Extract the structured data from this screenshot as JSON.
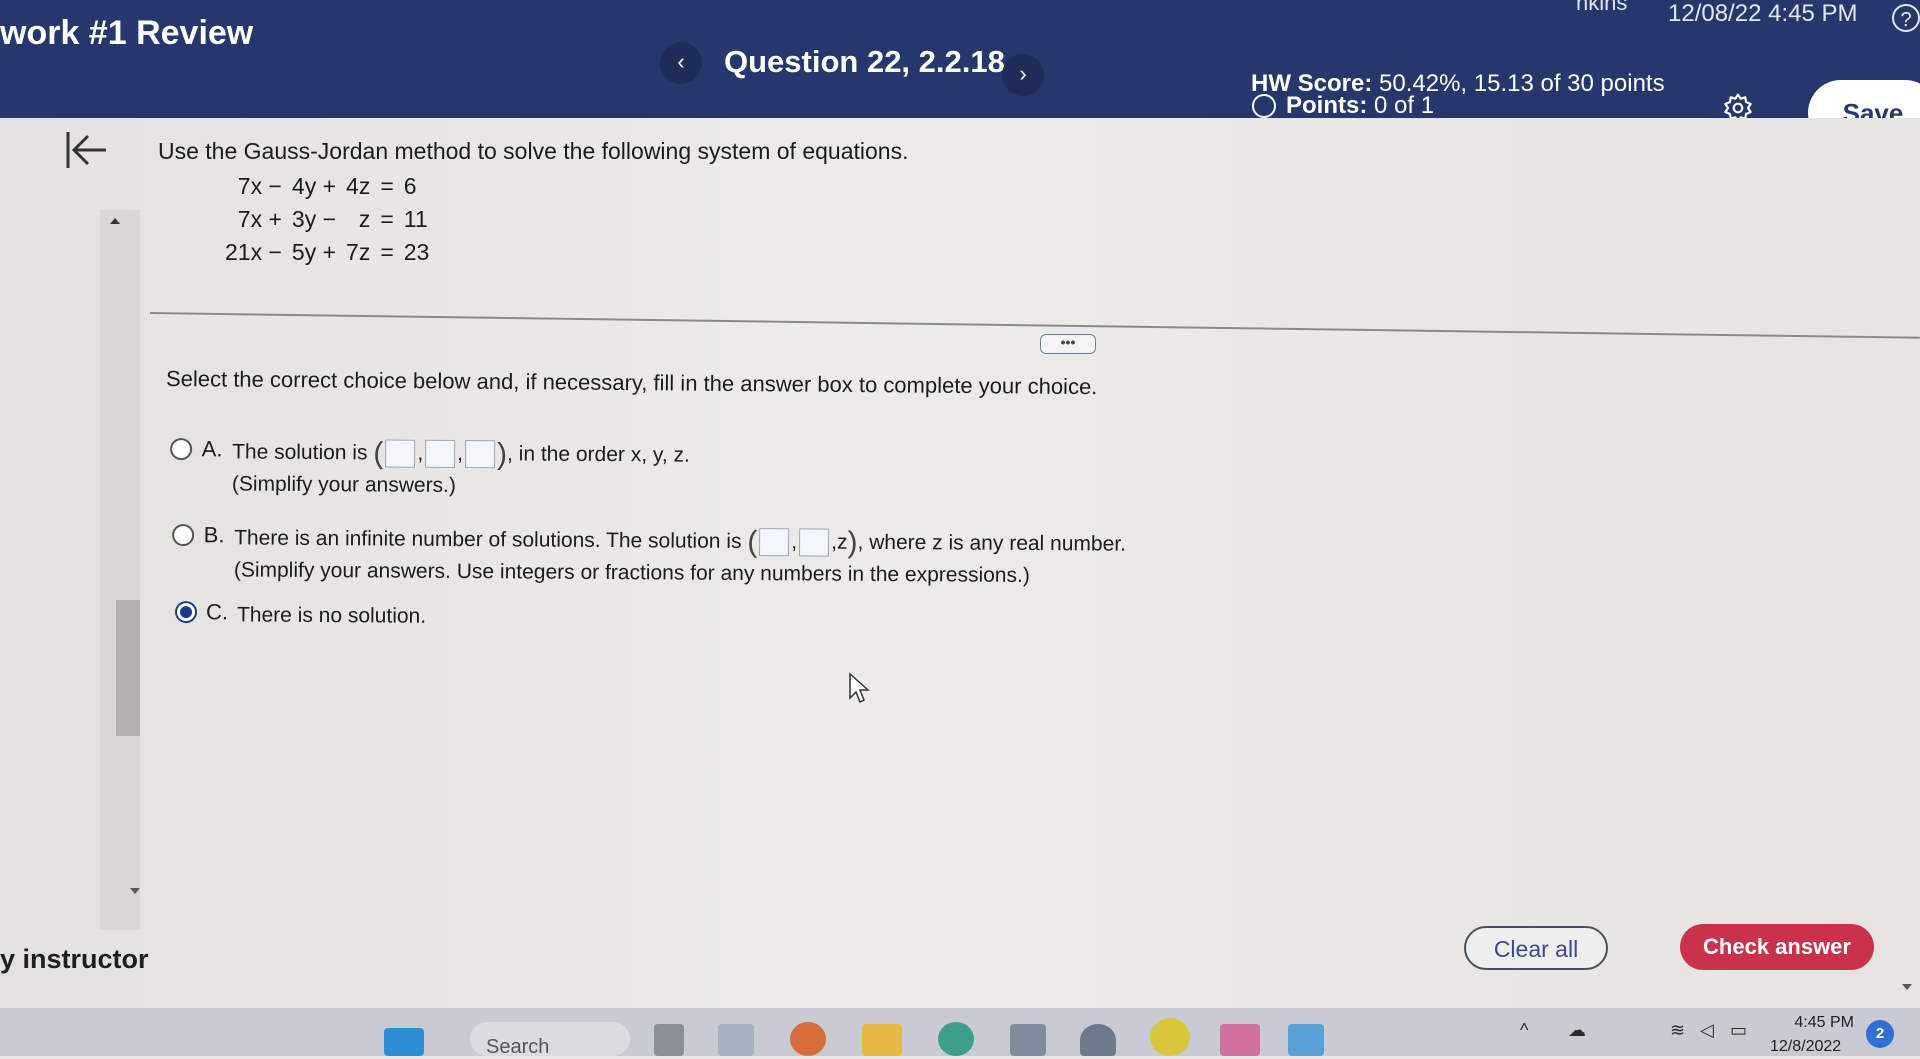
{
  "header": {
    "assignment_title": "work #1 Review",
    "datetime": "12/08/22 4:45 PM",
    "datetime_partial": "nkins",
    "help_label": "?",
    "prev_label": "‹",
    "question_title": "Question 22, 2.2.18",
    "next_label": "›",
    "hw_score_label": "HW Score:",
    "hw_score_value": "50.42%, 15.13 of 30 points",
    "points_label": "Points:",
    "points_value": "0 of 1",
    "gear_icon": "gear-icon",
    "save_label": "Save"
  },
  "question": {
    "prompt": "Use the Gauss-Jordan method to solve the following system of equations.",
    "equations": [
      [
        "7x −",
        "4y +",
        "4z",
        "=",
        "6"
      ],
      [
        "7x +",
        "3y −",
        "z",
        "=",
        "11"
      ],
      [
        "21x −",
        "5y +",
        "7z",
        "=",
        "23"
      ]
    ],
    "more_label": "•••",
    "instructions": "Select the correct choice below and, if necessary, fill in the answer box to complete your choice."
  },
  "choices": {
    "a": {
      "letter": "A.",
      "text_before": "The solution is",
      "text_after": ", in the order x, y, z.",
      "subtext": "(Simplify your answers.)",
      "selected": false
    },
    "b": {
      "letter": "B.",
      "text_before": "There is an infinite number of solutions. The solution is",
      "z_label": "z",
      "text_after": ", where z is any real number.",
      "subtext": "(Simplify your answers. Use integers or fractions for any numbers in the expressions.)",
      "selected": false
    },
    "c": {
      "letter": "C.",
      "text": "There is no solution.",
      "selected": true
    }
  },
  "footer": {
    "instructor_label": "y instructor",
    "clear_label": "Clear all",
    "check_label": "Check answer"
  },
  "taskbar": {
    "search_label": "Search",
    "time": "4:45 PM",
    "date": "12/8/2022",
    "notification_count": "2"
  },
  "colors": {
    "header_bg": "#25376c",
    "check_button": "#c9324a",
    "selected_radio": "#1a3a8a"
  }
}
